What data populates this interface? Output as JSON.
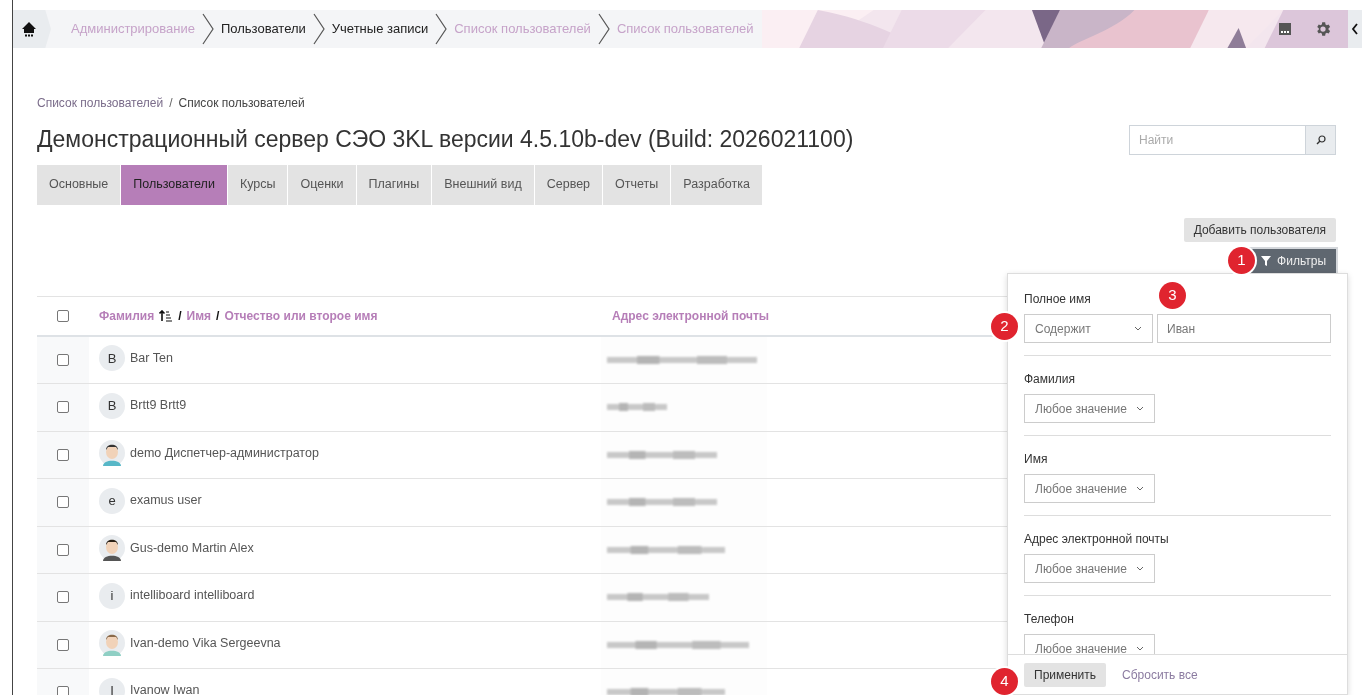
{
  "navbar": {
    "breadcrumb": [
      {
        "label": "Администрирование",
        "link": true
      },
      {
        "label": "Пользователи",
        "link": false
      },
      {
        "label": "Учетные записи",
        "link": false
      },
      {
        "label": "Список пользователей",
        "link": true
      },
      {
        "label": "Список пользователей",
        "link": true
      }
    ]
  },
  "page_breadcrumb_separator": "/",
  "page_breadcrumb": [
    {
      "label": "Список пользователей",
      "link": true
    },
    {
      "label": "Список пользователей",
      "link": false
    }
  ],
  "title": "Демонстрационный сервер СЭО 3KL версии 4.5.10b-dev (Build: 2026021100)",
  "search": {
    "placeholder": "Найти"
  },
  "tabs": [
    {
      "label": "Основные",
      "selected": false
    },
    {
      "label": "Пользователи",
      "selected": true
    },
    {
      "label": "Курсы",
      "selected": false
    },
    {
      "label": "Оценки",
      "selected": false
    },
    {
      "label": "Плагины",
      "selected": false
    },
    {
      "label": "Внешний вид",
      "selected": false
    },
    {
      "label": "Сервер",
      "selected": false
    },
    {
      "label": "Отчеты",
      "selected": false
    },
    {
      "label": "Разработка",
      "selected": false
    }
  ],
  "add_user_button": "Добавить пользователя",
  "filters_button": "Фильтры",
  "table": {
    "select_all_checked": false,
    "column_separator": "/",
    "name_columns": [
      "Фамилия",
      "Имя",
      "Отчество или второе имя"
    ],
    "email_column": "Адрес электронной почты",
    "rows": [
      {
        "checked": false,
        "name": "Bar Ten",
        "avatar": {
          "kind": "letter",
          "letter": "B"
        }
      },
      {
        "checked": false,
        "name": "Brtt9 Brtt9",
        "avatar": {
          "kind": "letter",
          "letter": "B"
        }
      },
      {
        "checked": false,
        "name": "demo Диспетчер-администратор"
      },
      {
        "checked": false,
        "name": "examus user",
        "avatar": {
          "kind": "letter",
          "letter": "e"
        }
      },
      {
        "checked": false,
        "name": "Gus-demo Martin Alex"
      },
      {
        "checked": false,
        "name": "intelliboard intelliboard",
        "avatar": {
          "kind": "letter",
          "letter": "i"
        }
      },
      {
        "checked": false,
        "name": "Ivan-demo Vika Sergeevna"
      },
      {
        "checked": false,
        "name": "Ivanow Iwan",
        "avatar": {
          "kind": "letter",
          "letter": "I"
        }
      }
    ]
  },
  "filter_panel": {
    "fields": [
      {
        "label": "Полное имя",
        "kind": "text",
        "operator": "Содержит",
        "value": "Иван"
      },
      {
        "label": "Фамилия",
        "kind": "select",
        "value": "Любое значение"
      },
      {
        "label": "Имя",
        "kind": "select",
        "value": "Любое значение"
      },
      {
        "label": "Адрес электронной почты",
        "kind": "select",
        "value": "Любое значение"
      },
      {
        "label": "Телефон",
        "kind": "select",
        "value": "Любое значение"
      }
    ],
    "apply_button": "Применить",
    "reset_link": "Сбросить все"
  },
  "callouts": [
    "1",
    "2",
    "3",
    "4"
  ]
}
